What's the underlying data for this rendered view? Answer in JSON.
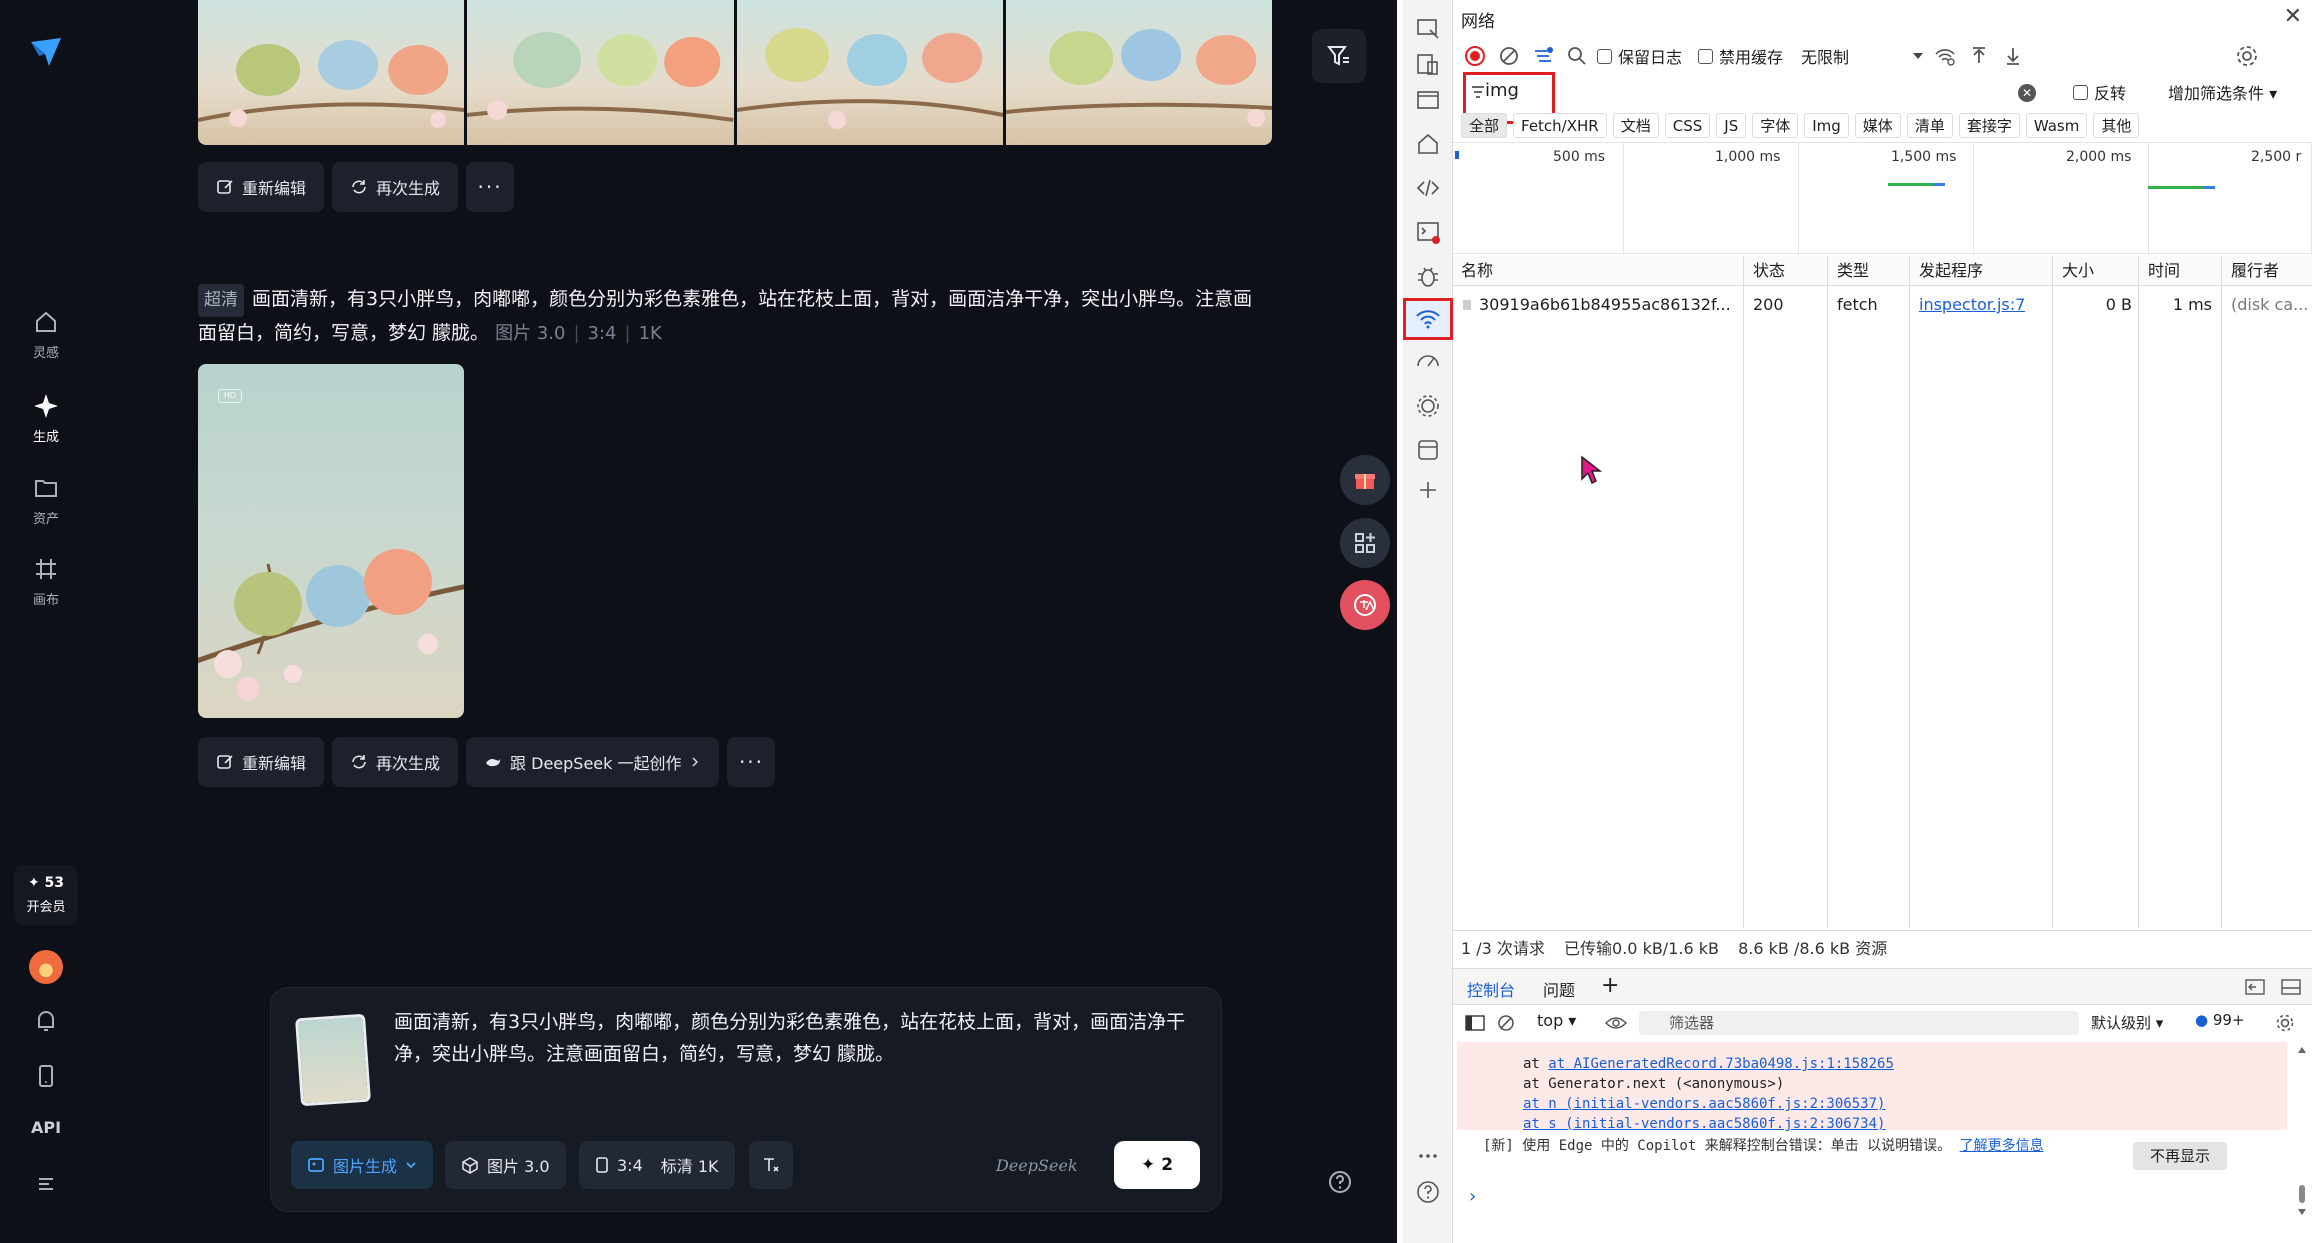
{
  "app": {
    "nav": [
      {
        "key": "inspiration",
        "label": "灵感"
      },
      {
        "key": "generate",
        "label": "生成"
      },
      {
        "key": "assets",
        "label": "资产"
      },
      {
        "key": "canvas",
        "label": "画布"
      }
    ],
    "points": "✦ 53",
    "vip_label": "开会员",
    "api_label": "API",
    "actions_top": {
      "re_edit": "重新编辑",
      "regenerate": "再次生成",
      "more": "···"
    },
    "record": {
      "quality_badge": "超清",
      "prompt": "画面清新，有3只小胖鸟，肉嘟嘟，颜色分别为彩色素雅色，站在花枝上面，背对，画面洁净干净，突出小胖鸟。注意画面留白，简约，写意，梦幻 朦胧。",
      "model": "图片 3.0",
      "ratio": "3:4",
      "resolution": "1K",
      "hd_mark": "HD"
    },
    "actions_bottom": {
      "re_edit": "重新编辑",
      "regenerate": "再次生成",
      "deepseek": "跟 DeepSeek 一起创作",
      "more": "···"
    },
    "composer": {
      "text": "画面清新，有3只小胖鸟，肉嘟嘟，颜色分别为彩色素雅色，站在花枝上面，背对，画面洁净干净，突出小胖鸟。注意画面留白，简约，写意，梦幻 朦胧。",
      "mode": "图片生成",
      "model": "图片 3.0",
      "ratio": "3:4",
      "quality": "标清 1K",
      "deepseek_logo": "DeepSeek",
      "send_count": "2"
    },
    "colors": {
      "bg": "#0d1017",
      "accent": "#4ea4ff"
    }
  },
  "devtools": {
    "panel_title": "网络",
    "toolbar": {
      "preserve_log": "保留日志",
      "disable_cache": "禁用缓存",
      "throttle": "无限制"
    },
    "filter": {
      "value": "img",
      "invert": "反转",
      "more_filters": "增加筛选条件"
    },
    "type_tabs": [
      "全部",
      "Fetch/XHR",
      "文档",
      "CSS",
      "JS",
      "字体",
      "Img",
      "媒体",
      "清单",
      "套接字",
      "Wasm",
      "其他"
    ],
    "timeline_labels": [
      "500 ms",
      "1,000 ms",
      "1,500 ms",
      "2,000 ms",
      "2,500 r"
    ],
    "columns": [
      "名称",
      "状态",
      "类型",
      "发起程序",
      "大小",
      "时间",
      "履行者"
    ],
    "rows": [
      {
        "name": "30919a6b61b84955ac86132f...",
        "status": "200",
        "type": "fetch",
        "initiator": "inspector.js:7",
        "size": "0 B",
        "time": "1 ms",
        "fulfilled": "(disk ca..."
      }
    ],
    "status_bar": {
      "requests": "1 /3 次请求",
      "transferred": "已传输0.0 kB/1.6 kB",
      "resources": "8.6 kB /8.6 kB 资源"
    },
    "drawer": {
      "console_tab": "控制台",
      "issues_tab": "问题",
      "context": "top",
      "filter_placeholder": "筛选器",
      "level": "默认级别",
      "issue_count": "99+"
    },
    "console_lines": [
      "at AIGeneratedRecord.73ba0498.js:1:158265",
      "at Generator.next (<anonymous>)",
      "at n (initial-vendors.aac5860f.js:2:306537)",
      "at s (initial-vendors.aac5860f.js:2:306734)"
    ],
    "tip": {
      "text": "[新] 使用 Edge 中的 Copilot 来解释控制台错误：单击  以说明错误。",
      "link": "了解更多信息",
      "dismiss": "不再显示"
    }
  }
}
